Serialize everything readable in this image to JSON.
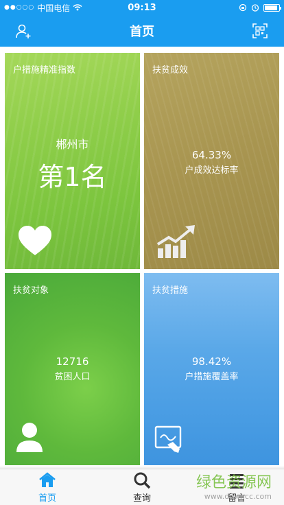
{
  "status": {
    "carrier": "中国电信",
    "time": "09:13",
    "battery_level": 0.9
  },
  "nav": {
    "title": "首页",
    "left_icon": "add-user-icon",
    "right_icon": "scan-icon"
  },
  "tiles": [
    {
      "label": "户措施精准指数",
      "city": "郴州市",
      "rank": "第1名",
      "icon": "heart-icon"
    },
    {
      "label": "扶贫成效",
      "value": "64.33%",
      "caption": "户成效达标率",
      "icon": "growth-chart-icon"
    },
    {
      "label": "扶贫对象",
      "value": "12716",
      "caption": "贫困人口",
      "icon": "person-icon"
    },
    {
      "label": "扶贫措施",
      "value": "98.42%",
      "caption": "户措施覆盖率",
      "icon": "document-edit-icon"
    }
  ],
  "tabs": [
    {
      "label": "首页",
      "icon": "home-icon",
      "active": true
    },
    {
      "label": "查询",
      "icon": "search-icon",
      "active": false
    },
    {
      "label": "留言",
      "icon": "message-list-icon",
      "active": false
    }
  ],
  "watermark": {
    "main": "绿色资源网",
    "sub": "www.downcc.com"
  },
  "colors": {
    "primary": "#1a9df0"
  }
}
